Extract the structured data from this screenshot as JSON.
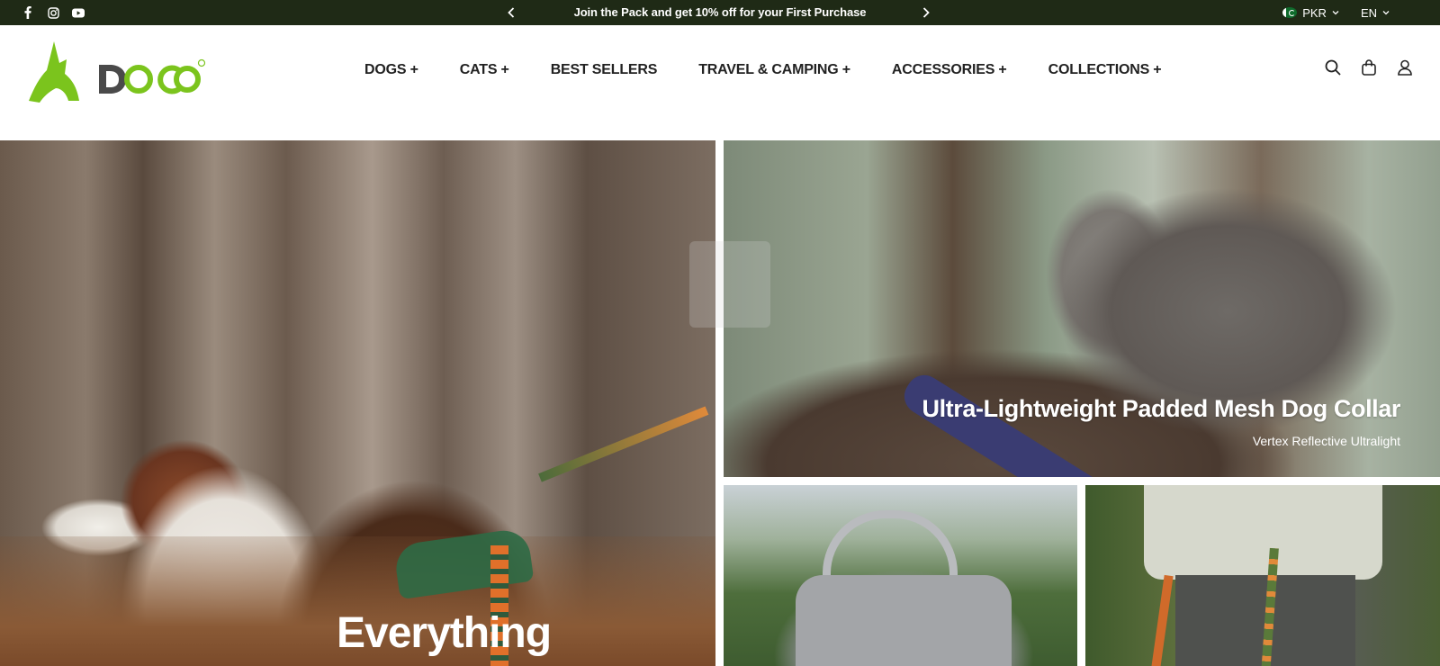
{
  "announcement": {
    "text": "Join the Pack and get 10% off for your First Purchase",
    "social": [
      "facebook-icon",
      "instagram-icon",
      "youtube-icon"
    ]
  },
  "locale": {
    "currency": "PKR",
    "language": "EN"
  },
  "brand": {
    "logo_text": "DOCO",
    "logo_color": "#7bc41d",
    "logo_dark": "#4a4a4a"
  },
  "nav": {
    "items": [
      {
        "label": "DOGS +"
      },
      {
        "label": "CATS +"
      },
      {
        "label": "BEST SELLERS"
      },
      {
        "label": "TRAVEL & CAMPING +"
      },
      {
        "label": "ACCESSORIES +"
      },
      {
        "label": "COLLECTIONS +"
      }
    ]
  },
  "header_icons": [
    "search-icon",
    "cart-icon",
    "account-icon"
  ],
  "hero": {
    "main_title": "Everything",
    "collar_title": "Ultra-Lightweight Padded Mesh Dog Collar",
    "collar_subtitle": "Vertex Reflective Ultralight"
  },
  "colors": {
    "topbar_bg": "#1f2a16",
    "accent": "#7bc41d"
  }
}
